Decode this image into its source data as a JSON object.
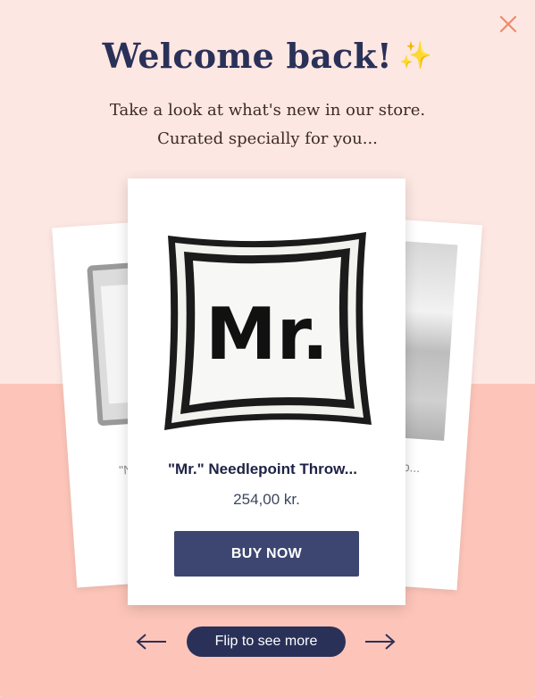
{
  "popup": {
    "title": "Welcome back!",
    "title_emoji": "✨",
    "subtitle_line1": "Take a look at what's new in our store.",
    "subtitle_line2": "Curated specially for you...",
    "close_icon": "close-icon"
  },
  "carousel": {
    "left_card": {
      "name_fragment": "\"N"
    },
    "right_card": {
      "name_fragment": "b..."
    },
    "main_card": {
      "pillow_text": "Mr.",
      "product_name": "\"Mr.\" Needlepoint Throw...",
      "price": "254,00 kr.",
      "button_label": "BUY NOW"
    },
    "prev_icon": "arrow-left-icon",
    "next_icon": "arrow-right-icon",
    "flip_label": "Flip to see more"
  },
  "colors": {
    "title": "#2a3158",
    "accent_close": "#f08a6b",
    "background_top": "#fde7e3",
    "background_bottom": "#fdc5b9",
    "button": "#3d4670",
    "flip_button": "#2a3158"
  }
}
